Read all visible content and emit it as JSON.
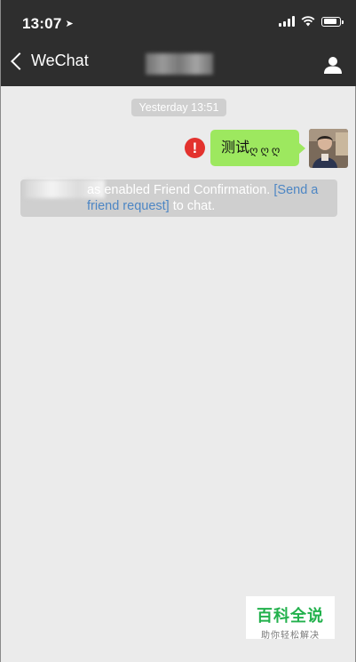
{
  "status_bar": {
    "time": "13:07",
    "location_arrow": "location-arrow-icon",
    "battery_level": 0.85
  },
  "nav": {
    "back_label": "WeChat",
    "contact_name_obscured": true
  },
  "chat": {
    "timestamp": "Yesterday 13:51",
    "outgoing_message": {
      "text": "测试",
      "emojis": "ღღღ",
      "status": "failed"
    },
    "system_notice": {
      "text_1": "as enabled Friend Confirmation. ",
      "link_text": "[Send a friend request]",
      "text_2": " to chat."
    }
  },
  "watermark": {
    "title": "百科全说",
    "subtitle": "助你轻松解决"
  },
  "colors": {
    "nav_bg": "#2e2e2e",
    "chat_bg": "#ebebeb",
    "bubble": "#9de85f",
    "error": "#e3322e",
    "link": "#4d86c4",
    "watermark": "#22b14c"
  }
}
